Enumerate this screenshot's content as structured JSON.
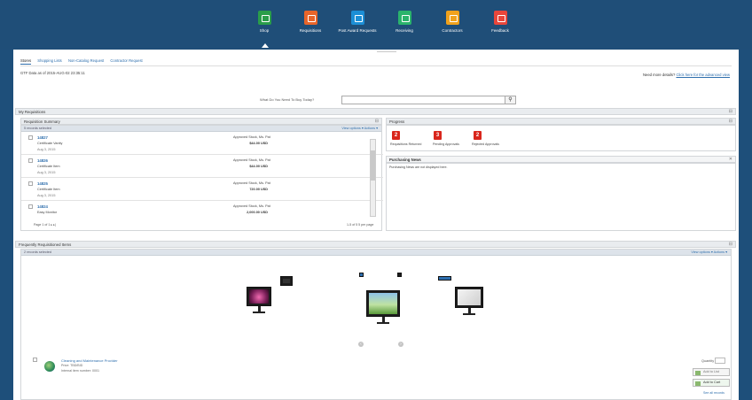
{
  "nav": [
    {
      "label": "Shop",
      "icon": "shop-icon",
      "color": "#2a9d4a"
    },
    {
      "label": "Requisitions",
      "icon": "cart-icon",
      "color": "#e8652a"
    },
    {
      "label": "Post Award Requests",
      "icon": "trophy-icon",
      "color": "#1c8fd6"
    },
    {
      "label": "Receiving",
      "icon": "truck-icon",
      "color": "#2bb36c"
    },
    {
      "label": "Contractors",
      "icon": "person-icon",
      "color": "#f0a21c"
    },
    {
      "label": "Feedback",
      "icon": "chat-icon",
      "color": "#e8463b"
    }
  ],
  "tabs": [
    "Stores",
    "Shopping Lists",
    "Non-Catalog Request",
    "Contractor Request"
  ],
  "as_of": "GTF Data as of 2015-AUG-02 23:35:11",
  "more_details": {
    "text": "Need more details?",
    "link": "Click here for the advanced view"
  },
  "search": {
    "label": "What Do You Need To Buy Today?",
    "placeholder": ""
  },
  "my_requisitions": "My Requisitions",
  "req_summary": {
    "title": "Requisition Summary",
    "count": "5 records selected",
    "view_label": "View options ▾  Actions ▾",
    "items": [
      {
        "num": "14827",
        "desc": "Certificate Vanity",
        "sub": "Aug 3, 2015",
        "status": "Approved  Stock, Ms. Pat",
        "amount": "$44.00 USD"
      },
      {
        "num": "14826",
        "desc": "Certificate Item",
        "sub": "Aug 3, 2015",
        "status": "Approved  Stock, Ms. Pat",
        "amount": "$44.00 USD"
      },
      {
        "num": "14825",
        "desc": "Certificate Item",
        "sub": "Aug 3, 2015",
        "status": "Approved  Stock, Ms. Pat",
        "amount": "720.00 USD"
      },
      {
        "num": "14824",
        "desc": "Easy Monitor",
        "sub": "Aug 2, 2015",
        "status": "Approved  Stock, Ms. Pat",
        "amount": "2,000.00 USD"
      }
    ],
    "pager_left": "Page  1  of 1  ▸ ▸|",
    "pager_right": "1-5 of 5   5 per page"
  },
  "progress": {
    "title": "Progress",
    "badges": [
      {
        "value": "2",
        "label": "Requisitions Returned"
      },
      {
        "value": "3",
        "label": "Pending Approvals"
      },
      {
        "value": "2",
        "label": "Rejected Approvals"
      }
    ]
  },
  "news": {
    "title": "Purchasing News",
    "body": "Purchasing News are not displayed here."
  },
  "frequent": {
    "title": "Frequently Requisitioned Items",
    "count": "2 records selected",
    "actions": "View options ▾  Actions ▾",
    "item": {
      "name": "Cleaning and Maintenance Provider",
      "line1": "Price: TBD/BID",
      "line2": "Internal item number: 0001"
    },
    "quantity_label": "Quantity",
    "add_list": "Add to List",
    "add_cart": "Add to Cart",
    "records": "See all records"
  }
}
